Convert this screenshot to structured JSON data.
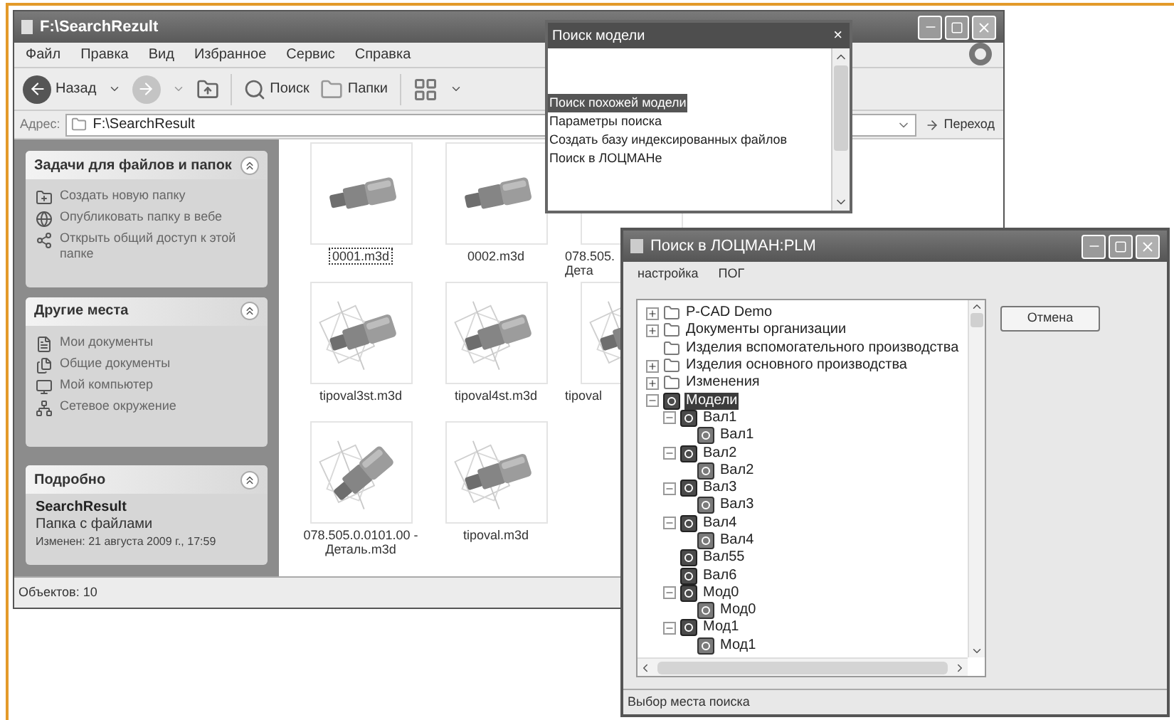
{
  "explorer": {
    "title": "F:\\SearchRezult",
    "menu": [
      "Файл",
      "Правка",
      "Вид",
      "Избранное",
      "Сервис",
      "Справка"
    ],
    "toolbar": {
      "back": "Назад",
      "search": "Поиск",
      "folders": "Папки"
    },
    "address": {
      "label": "Адрес:",
      "value": "F:\\SearchResult",
      "go": "Переход"
    },
    "task_panes": [
      {
        "title": "Задачи для файлов и папок",
        "items": [
          {
            "kind": "new-folder",
            "label": "Создать новую папку"
          },
          {
            "kind": "web",
            "label": "Опубликовать папку в вебе"
          },
          {
            "kind": "share",
            "label": "Открыть общий доступ к этой папке"
          }
        ]
      },
      {
        "title": "Другие места",
        "items": [
          {
            "kind": "documents",
            "label": "Мои документы"
          },
          {
            "kind": "shared",
            "label": "Общие документы"
          },
          {
            "kind": "computer",
            "label": "Мой компьютер"
          },
          {
            "kind": "network",
            "label": "Сетевое окружение"
          }
        ]
      }
    ],
    "details": {
      "title": "Подробно",
      "name": "SearchResult",
      "type": "Папка с файлами",
      "modified": "Изменен: 21 августа 2009 г., 17:59"
    },
    "files": [
      {
        "lines": [
          "0001.m3d"
        ],
        "selected": true
      },
      {
        "lines": [
          "0002.m3d"
        ],
        "selected": false
      },
      {
        "lines": [
          "078.505.",
          "Дета"
        ],
        "selected": false
      },
      {
        "lines": [
          "tipoval3st.m3d"
        ],
        "selected": false
      },
      {
        "lines": [
          "tipoval4st.m3d"
        ],
        "selected": false
      },
      {
        "lines": [
          "tipoval"
        ],
        "selected": false
      },
      {
        "lines": [
          "078.505.0.0101.00 -",
          "Деталь.m3d"
        ],
        "selected": false
      },
      {
        "lines": [
          "tipoval.m3d"
        ],
        "selected": false
      }
    ],
    "status": "Объектов: 10"
  },
  "model_search": {
    "title": "Поиск модели",
    "close": "×",
    "items": [
      {
        "label": "Поиск похожей модели",
        "selected": true
      },
      {
        "label": "Параметры поиска",
        "selected": false
      },
      {
        "label": "Создать базу индексированных файлов",
        "selected": false
      },
      {
        "label": "Поиск в ЛОЦМАНе",
        "selected": false
      }
    ]
  },
  "plm": {
    "title": "Поиск в ЛОЦМАН:PLM",
    "menu": [
      "настройка",
      "ПОГ"
    ],
    "tree": [
      {
        "label": "P-CAD Demo",
        "kind": "folder",
        "expanded": false,
        "selected": false
      },
      {
        "label": "Документы организации",
        "kind": "folder",
        "expanded": false,
        "selected": false
      },
      {
        "label": "Изделия вспомогательного производства",
        "kind": "folder",
        "selected": false
      },
      {
        "label": "Изделия основного производства",
        "kind": "folder",
        "expanded": false,
        "selected": false
      },
      {
        "label": "Изменения",
        "kind": "folder",
        "expanded": false,
        "selected": false
      },
      {
        "label": "Модели",
        "kind": "model",
        "expanded": true,
        "selected": true,
        "children": [
          {
            "label": "Вал1",
            "kind": "model",
            "expanded": true,
            "selected": false,
            "children": [
              {
                "label": "Вал1",
                "kind": "part",
                "selected": false
              }
            ]
          },
          {
            "label": "Вал2",
            "kind": "model",
            "expanded": true,
            "selected": false,
            "children": [
              {
                "label": "Вал2",
                "kind": "part",
                "selected": false
              }
            ]
          },
          {
            "label": "Вал3",
            "kind": "model",
            "expanded": true,
            "selected": false,
            "children": [
              {
                "label": "Вал3",
                "kind": "part",
                "selected": false
              }
            ]
          },
          {
            "label": "Вал4",
            "kind": "model",
            "expanded": true,
            "selected": false,
            "children": [
              {
                "label": "Вал4",
                "kind": "part",
                "selected": false
              }
            ]
          },
          {
            "label": "Вал55",
            "kind": "model",
            "selected": false
          },
          {
            "label": "Вал6",
            "kind": "model",
            "selected": false
          },
          {
            "label": "Мод0",
            "kind": "model",
            "expanded": true,
            "selected": false,
            "children": [
              {
                "label": "Мод0",
                "kind": "part",
                "selected": false
              }
            ]
          },
          {
            "label": "Мод1",
            "kind": "model",
            "expanded": true,
            "selected": false,
            "children": [
              {
                "label": "Мод1",
                "kind": "part",
                "selected": false
              }
            ]
          }
        ]
      }
    ],
    "cancel": "Отмена",
    "status": "Выбор места поиска"
  }
}
